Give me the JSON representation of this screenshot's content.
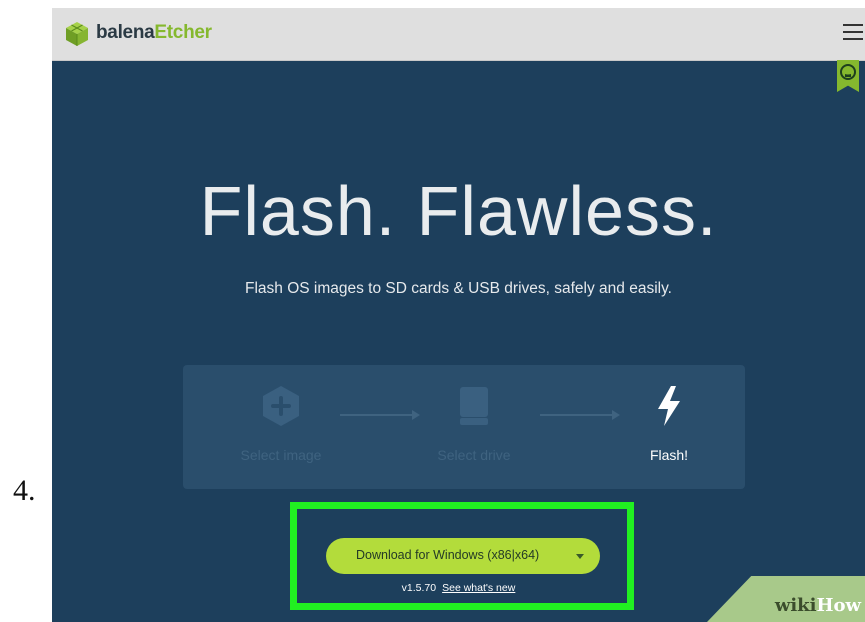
{
  "step_number": "4.",
  "header": {
    "brand_part1": "balena",
    "brand_part2": "Etcher",
    "icons": [
      "cube-logo-icon",
      "hamburger-menu-icon",
      "github-icon"
    ]
  },
  "hero": {
    "title": "Flash. Flawless.",
    "subtitle": "Flash OS images to SD cards & USB drives, safely and easily."
  },
  "steps": [
    {
      "label": "Select image",
      "icon": "plus-hexagon-icon",
      "state": "dim"
    },
    {
      "label": "Select drive",
      "icon": "drive-icon",
      "state": "dim"
    },
    {
      "label": "Flash!",
      "icon": "lightning-icon",
      "state": "active"
    }
  ],
  "download": {
    "button_label": "Download for Windows (x86|x64)",
    "version": "v1.5.70",
    "whats_new": "See what's new"
  },
  "watermark": {
    "part1": "wiki",
    "part2": "How"
  },
  "colors": {
    "page_bg": "#1d3f5c",
    "accent_green": "#b3dc3b",
    "highlight": "#21f021",
    "brand_green": "#85b82e"
  }
}
